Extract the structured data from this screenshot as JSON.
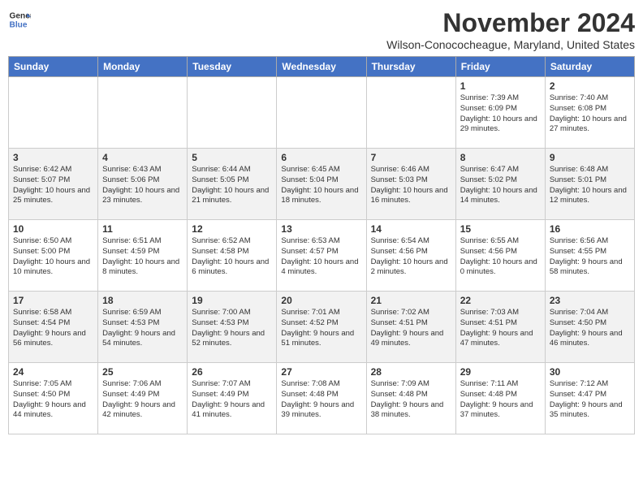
{
  "header": {
    "logo_line1": "General",
    "logo_line2": "Blue",
    "month": "November 2024",
    "location": "Wilson-Conococheague, Maryland, United States"
  },
  "weekdays": [
    "Sunday",
    "Monday",
    "Tuesday",
    "Wednesday",
    "Thursday",
    "Friday",
    "Saturday"
  ],
  "weeks": [
    [
      {
        "day": "",
        "info": ""
      },
      {
        "day": "",
        "info": ""
      },
      {
        "day": "",
        "info": ""
      },
      {
        "day": "",
        "info": ""
      },
      {
        "day": "",
        "info": ""
      },
      {
        "day": "1",
        "info": "Sunrise: 7:39 AM\nSunset: 6:09 PM\nDaylight: 10 hours and 29 minutes."
      },
      {
        "day": "2",
        "info": "Sunrise: 7:40 AM\nSunset: 6:08 PM\nDaylight: 10 hours and 27 minutes."
      }
    ],
    [
      {
        "day": "3",
        "info": "Sunrise: 6:42 AM\nSunset: 5:07 PM\nDaylight: 10 hours and 25 minutes."
      },
      {
        "day": "4",
        "info": "Sunrise: 6:43 AM\nSunset: 5:06 PM\nDaylight: 10 hours and 23 minutes."
      },
      {
        "day": "5",
        "info": "Sunrise: 6:44 AM\nSunset: 5:05 PM\nDaylight: 10 hours and 21 minutes."
      },
      {
        "day": "6",
        "info": "Sunrise: 6:45 AM\nSunset: 5:04 PM\nDaylight: 10 hours and 18 minutes."
      },
      {
        "day": "7",
        "info": "Sunrise: 6:46 AM\nSunset: 5:03 PM\nDaylight: 10 hours and 16 minutes."
      },
      {
        "day": "8",
        "info": "Sunrise: 6:47 AM\nSunset: 5:02 PM\nDaylight: 10 hours and 14 minutes."
      },
      {
        "day": "9",
        "info": "Sunrise: 6:48 AM\nSunset: 5:01 PM\nDaylight: 10 hours and 12 minutes."
      }
    ],
    [
      {
        "day": "10",
        "info": "Sunrise: 6:50 AM\nSunset: 5:00 PM\nDaylight: 10 hours and 10 minutes."
      },
      {
        "day": "11",
        "info": "Sunrise: 6:51 AM\nSunset: 4:59 PM\nDaylight: 10 hours and 8 minutes."
      },
      {
        "day": "12",
        "info": "Sunrise: 6:52 AM\nSunset: 4:58 PM\nDaylight: 10 hours and 6 minutes."
      },
      {
        "day": "13",
        "info": "Sunrise: 6:53 AM\nSunset: 4:57 PM\nDaylight: 10 hours and 4 minutes."
      },
      {
        "day": "14",
        "info": "Sunrise: 6:54 AM\nSunset: 4:56 PM\nDaylight: 10 hours and 2 minutes."
      },
      {
        "day": "15",
        "info": "Sunrise: 6:55 AM\nSunset: 4:56 PM\nDaylight: 10 hours and 0 minutes."
      },
      {
        "day": "16",
        "info": "Sunrise: 6:56 AM\nSunset: 4:55 PM\nDaylight: 9 hours and 58 minutes."
      }
    ],
    [
      {
        "day": "17",
        "info": "Sunrise: 6:58 AM\nSunset: 4:54 PM\nDaylight: 9 hours and 56 minutes."
      },
      {
        "day": "18",
        "info": "Sunrise: 6:59 AM\nSunset: 4:53 PM\nDaylight: 9 hours and 54 minutes."
      },
      {
        "day": "19",
        "info": "Sunrise: 7:00 AM\nSunset: 4:53 PM\nDaylight: 9 hours and 52 minutes."
      },
      {
        "day": "20",
        "info": "Sunrise: 7:01 AM\nSunset: 4:52 PM\nDaylight: 9 hours and 51 minutes."
      },
      {
        "day": "21",
        "info": "Sunrise: 7:02 AM\nSunset: 4:51 PM\nDaylight: 9 hours and 49 minutes."
      },
      {
        "day": "22",
        "info": "Sunrise: 7:03 AM\nSunset: 4:51 PM\nDaylight: 9 hours and 47 minutes."
      },
      {
        "day": "23",
        "info": "Sunrise: 7:04 AM\nSunset: 4:50 PM\nDaylight: 9 hours and 46 minutes."
      }
    ],
    [
      {
        "day": "24",
        "info": "Sunrise: 7:05 AM\nSunset: 4:50 PM\nDaylight: 9 hours and 44 minutes."
      },
      {
        "day": "25",
        "info": "Sunrise: 7:06 AM\nSunset: 4:49 PM\nDaylight: 9 hours and 42 minutes."
      },
      {
        "day": "26",
        "info": "Sunrise: 7:07 AM\nSunset: 4:49 PM\nDaylight: 9 hours and 41 minutes."
      },
      {
        "day": "27",
        "info": "Sunrise: 7:08 AM\nSunset: 4:48 PM\nDaylight: 9 hours and 39 minutes."
      },
      {
        "day": "28",
        "info": "Sunrise: 7:09 AM\nSunset: 4:48 PM\nDaylight: 9 hours and 38 minutes."
      },
      {
        "day": "29",
        "info": "Sunrise: 7:11 AM\nSunset: 4:48 PM\nDaylight: 9 hours and 37 minutes."
      },
      {
        "day": "30",
        "info": "Sunrise: 7:12 AM\nSunset: 4:47 PM\nDaylight: 9 hours and 35 minutes."
      }
    ]
  ]
}
